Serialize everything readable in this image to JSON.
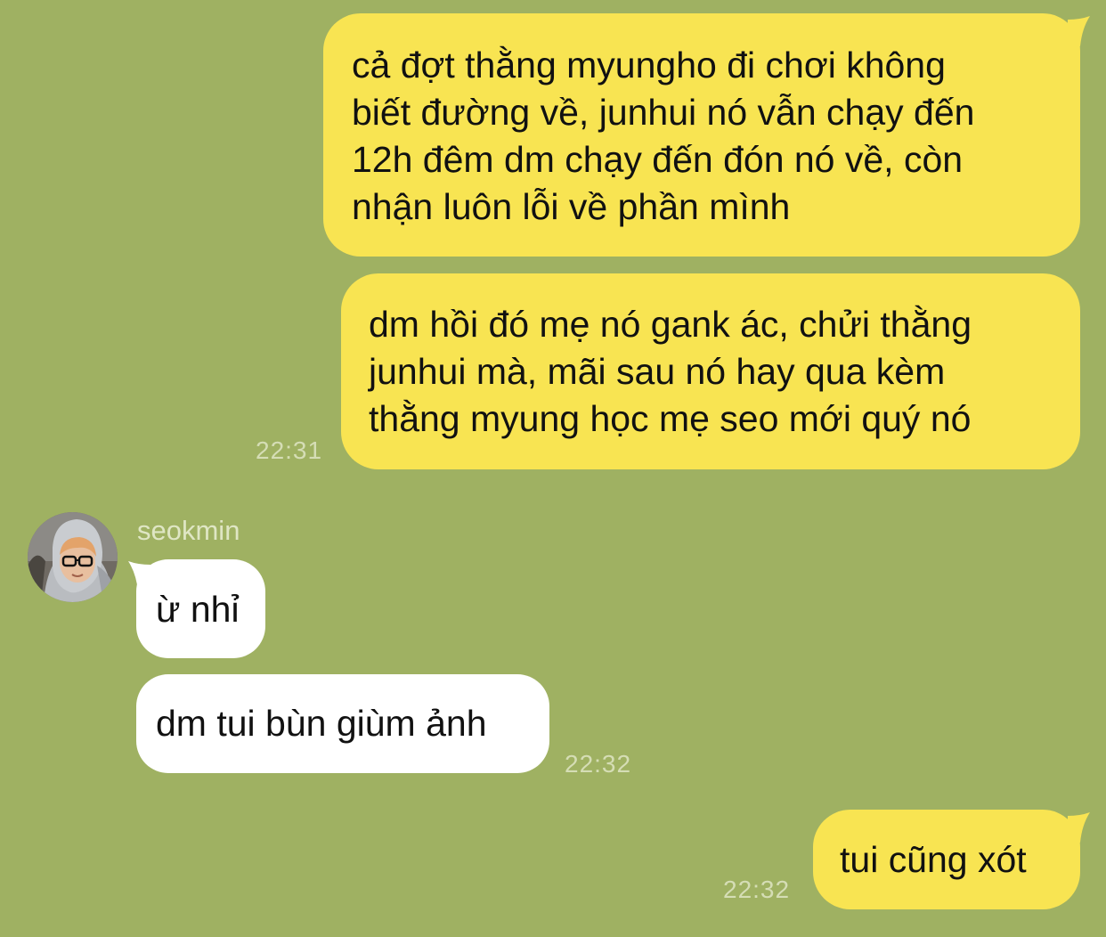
{
  "colors": {
    "background": "#9fb162",
    "outgoing_bubble": "#f8e452",
    "incoming_bubble": "#ffffff",
    "timestamp": "#d5ddb5"
  },
  "messages": {
    "out_1": "cả đợt thằng myungho đi chơi không\nbiết đường về, junhui nó vẫn chạy đến\n12h đêm dm chạy đến đón nó về, còn\nnhận luôn lỗi về phần mình",
    "out_2": "dm hồi đó mẹ nó gank ác, chửi thằng\njunhui mà, mãi sau nó hay qua kèm\nthằng myung học mẹ seo mới quý nó",
    "out_2_time": "22:31",
    "sender_name": "seokmin",
    "in_1": "ừ nhỉ",
    "in_2": "dm tui bùn giùm ảnh",
    "in_2_time": "22:32",
    "out_3": "tui cũng xót",
    "out_3_time": "22:32"
  }
}
